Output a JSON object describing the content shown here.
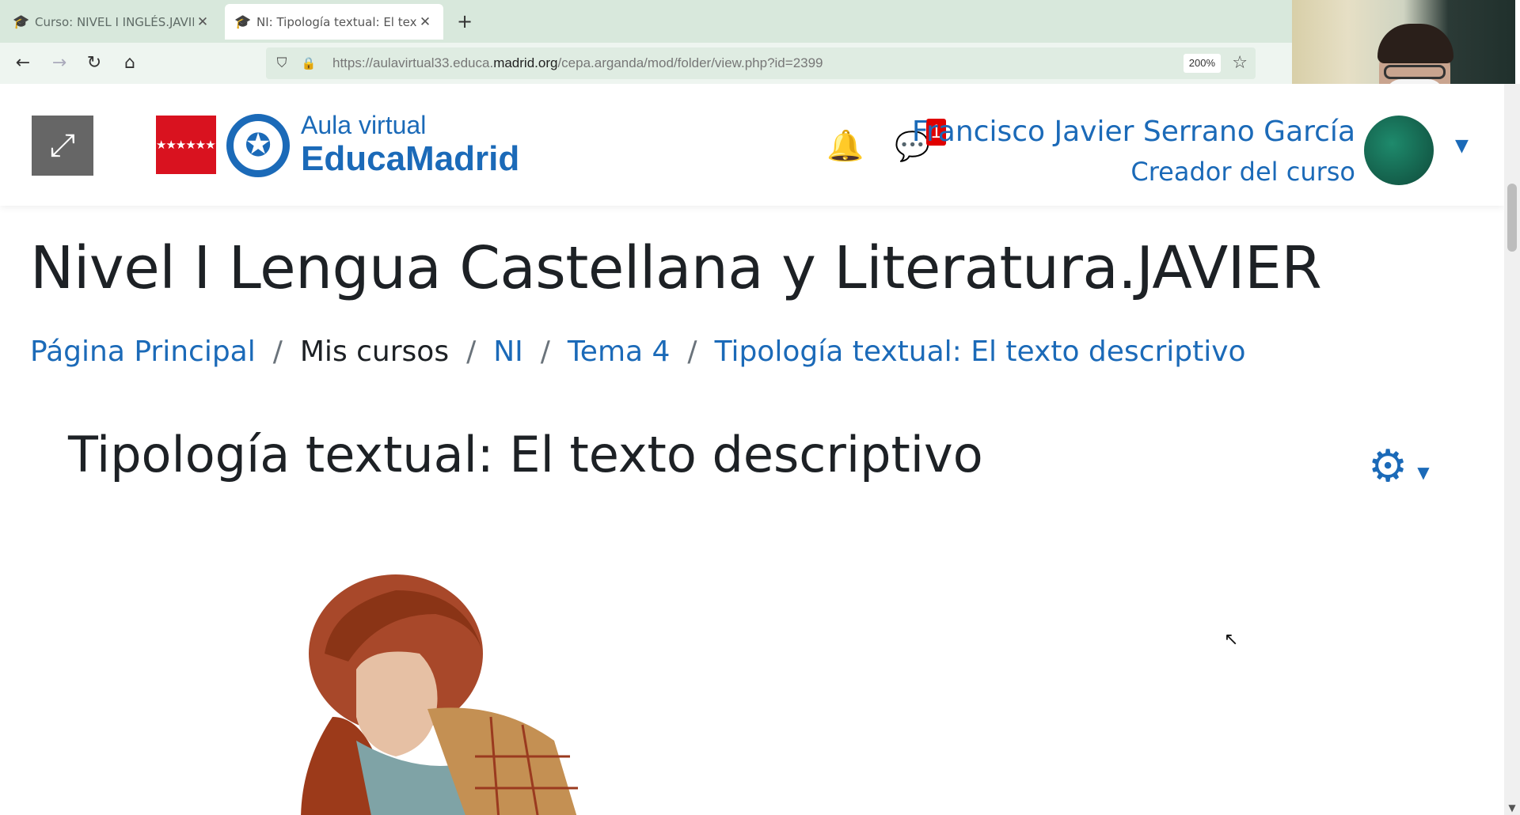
{
  "browser": {
    "tabs": [
      {
        "title": "Curso: NIVEL I INGLÉS.JAVIER",
        "close": "✕"
      },
      {
        "title": "NI: Tipología textual: El texto de",
        "close": "✕"
      }
    ],
    "new_tab": "+",
    "url_prefix": "https://aulavirtual33.educa.",
    "url_host": "madrid.org",
    "url_suffix": "/cepa.arganda/mod/folder/view.php?id=2399",
    "zoom": "200%"
  },
  "header": {
    "logo_line1": "Aula virtual",
    "logo_line2": "EducaMadrid",
    "flag_stars": "★★★★★★★",
    "message_count": "1",
    "user_name": "Francisco Javier Serrano García",
    "user_role": "Creador del curso"
  },
  "page": {
    "course_title": "Nivel I Lengua Castellana y Literatura.JAVIER",
    "breadcrumb": {
      "home": "Página Principal",
      "my_courses": "Mis cursos",
      "category": "NI",
      "section": "Tema 4",
      "activity": "Tipología textual: El texto descriptivo",
      "separator": "/"
    },
    "activity_title": "Tipología textual: El texto descriptivo"
  },
  "colors": {
    "link": "#1b6ab8",
    "text": "#1d2125",
    "badge": "#e00000",
    "flag": "#d9121f"
  },
  "icons": {
    "drawer": "expand-icon",
    "notifications": "bell-icon",
    "messages": "chat-icon",
    "settings": "gear-icon"
  }
}
